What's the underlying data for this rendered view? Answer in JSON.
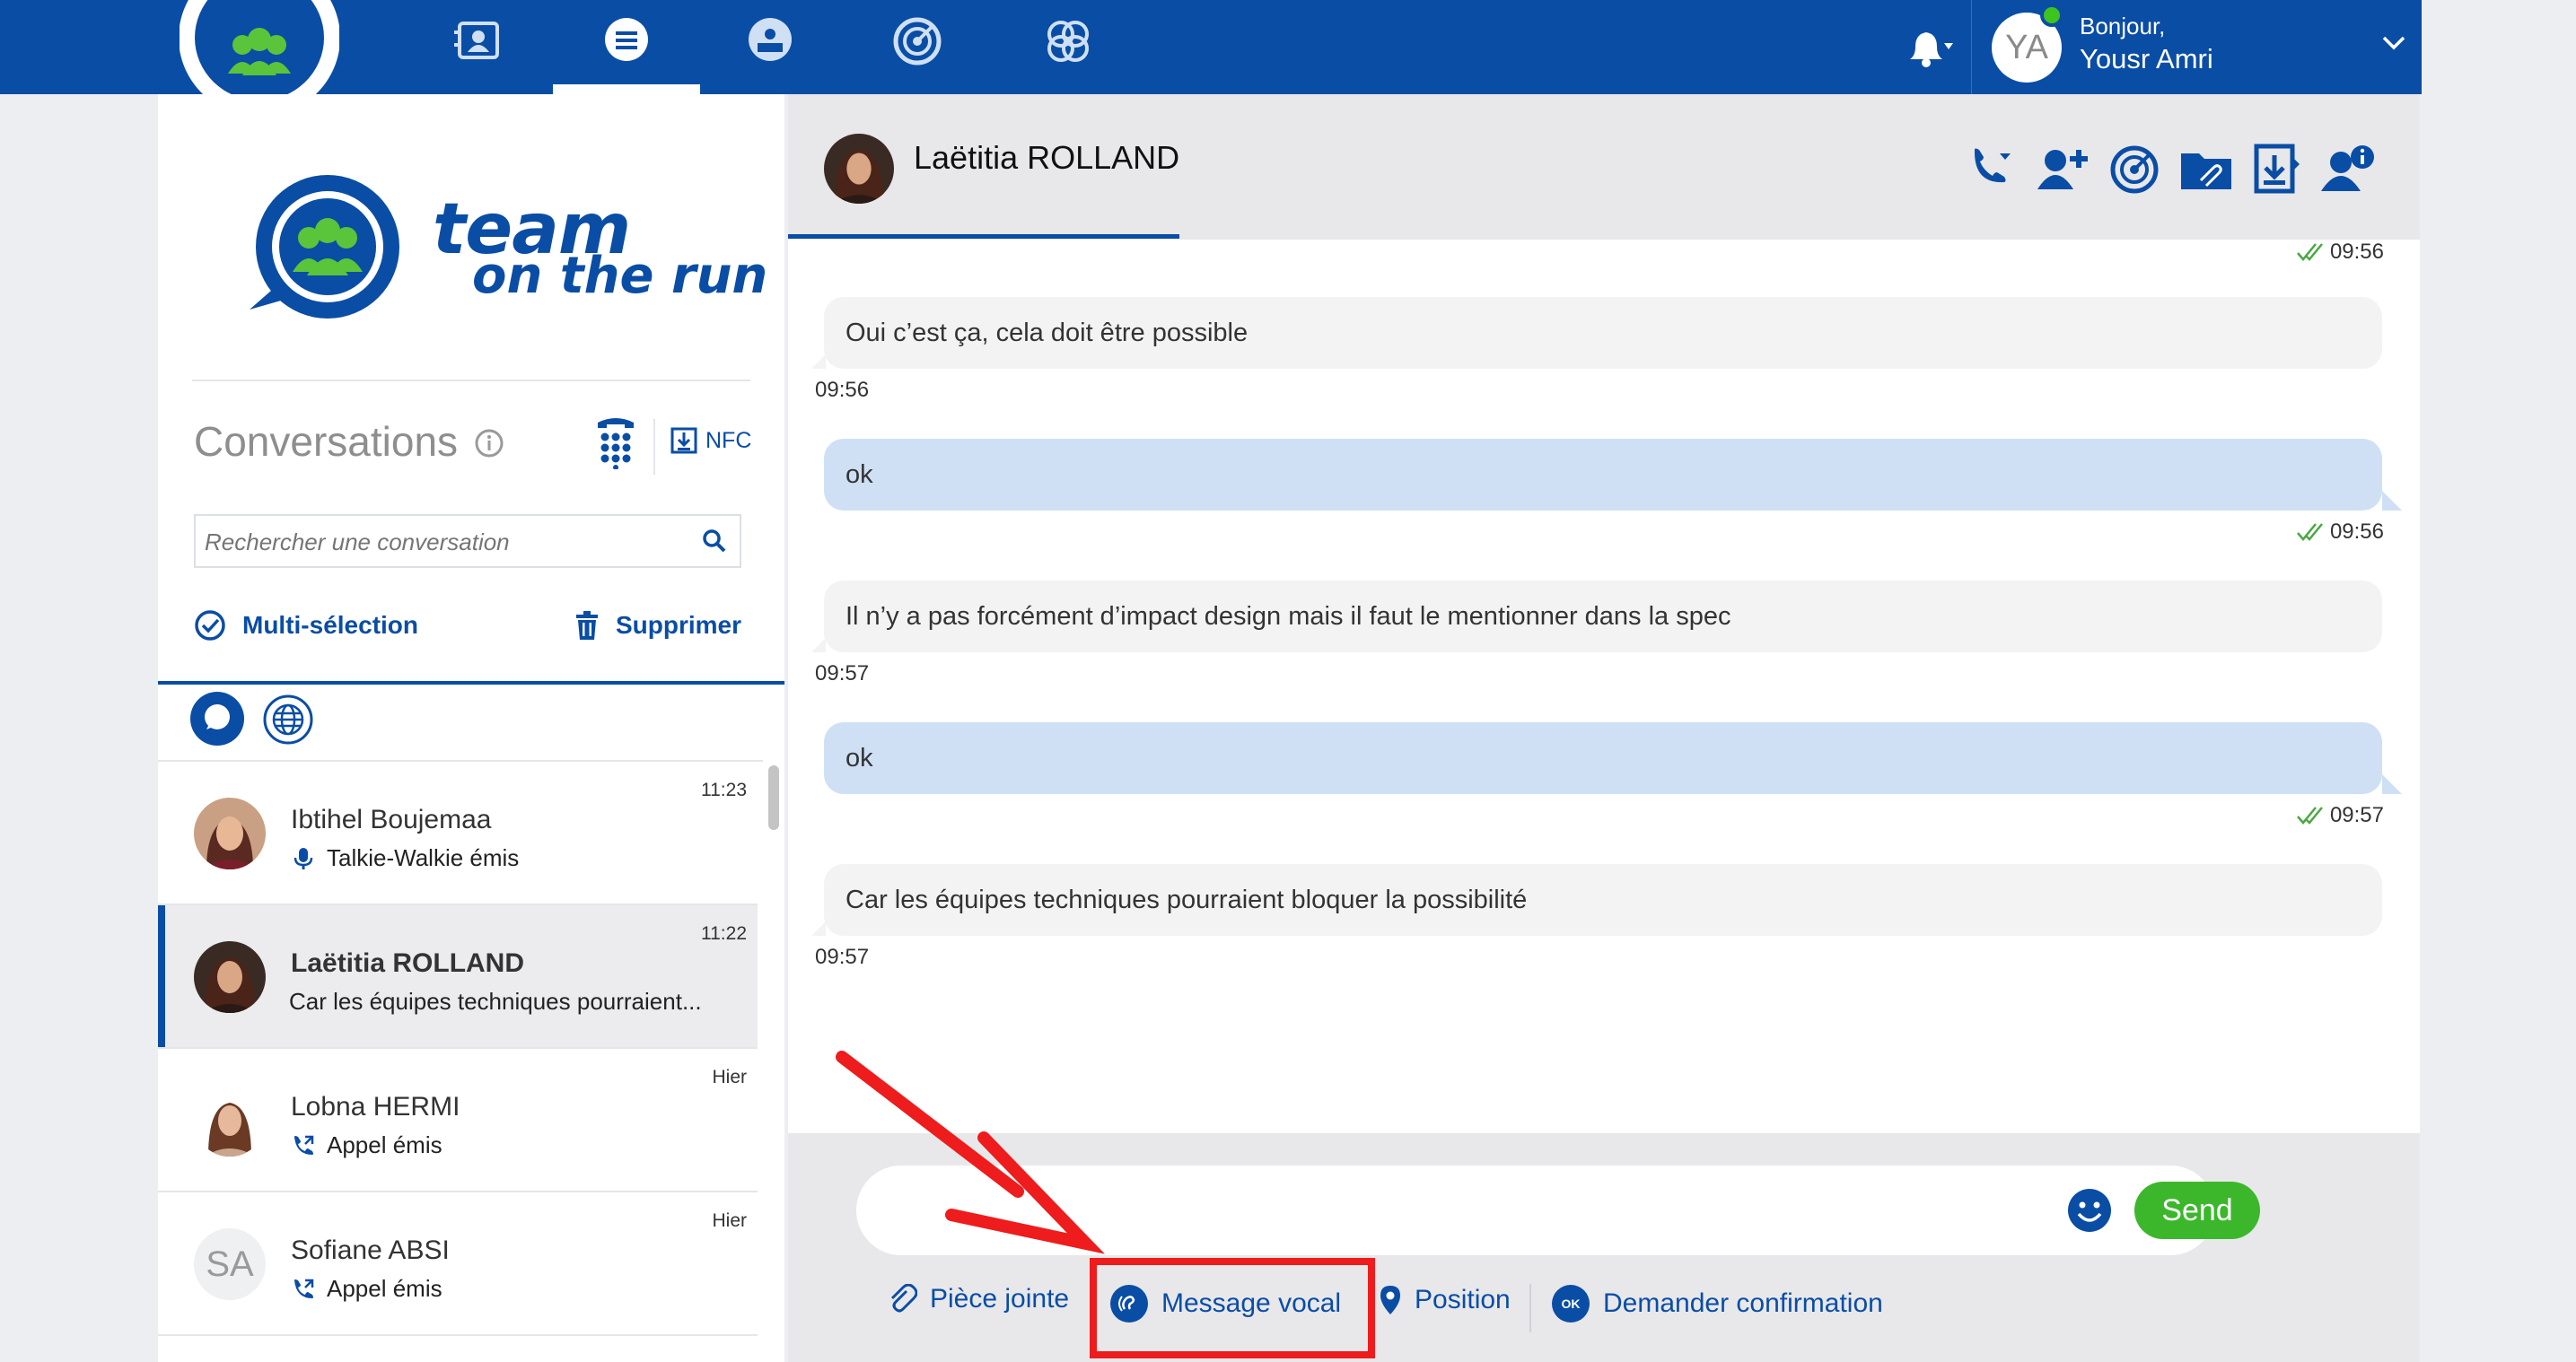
{
  "header": {
    "greeting": "Bonjour,",
    "user_name": "Yousr Amri",
    "user_initials": "YA",
    "nav_icons": [
      "contacts-icon",
      "conversations-icon",
      "broadcast-icon",
      "radar-icon",
      "groups-icon"
    ],
    "colors": {
      "brand_blue": "#0a4da5",
      "online_green": "#3ec41e"
    }
  },
  "sidebar": {
    "brand_line_1": "team",
    "brand_line_2": "on the run",
    "title": "Conversations",
    "nfc_label": "NFC",
    "search_placeholder": "Rechercher une conversation",
    "multi_select_label": "Multi-sélection",
    "delete_label": "Supprimer",
    "conversations": [
      {
        "name": "Ibtihel Boujemaa",
        "time": "11:23",
        "subtitle": "Talkie-Walkie émis",
        "icon": "walkie-talkie-icon"
      },
      {
        "name": "Laëtitia ROLLAND",
        "time": "11:22",
        "subtitle": "Car les équipes techniques pourraient...",
        "icon": ""
      },
      {
        "name": "Lobna HERMI",
        "time": "Hier",
        "subtitle": "Appel émis",
        "icon": "outgoing-call-icon"
      },
      {
        "name": "Sofiane ABSI",
        "time": "Hier",
        "subtitle": "Appel émis",
        "icon": "outgoing-call-icon",
        "initials": "SA"
      }
    ]
  },
  "chat": {
    "contact_name": "Laëtitia ROLLAND",
    "top_time": "09:56",
    "messages": [
      {
        "direction": "in",
        "text": "Oui c’est ça, cela doit être possible",
        "time": "09:56"
      },
      {
        "direction": "out",
        "text": "ok",
        "time": "09:56"
      },
      {
        "direction": "in",
        "text": "Il n’y a pas forcément d’impact design mais il faut le mentionner dans la spec",
        "time": "09:57"
      },
      {
        "direction": "out",
        "text": "ok",
        "time": "09:57"
      },
      {
        "direction": "in",
        "text": "Car les équipes techniques pourraient bloquer la possibilité",
        "time": "09:57"
      }
    ],
    "header_icons": [
      "call-icon",
      "add-user-icon",
      "radar-icon",
      "attachment-folder-icon",
      "download-icon",
      "user-info-icon"
    ]
  },
  "composer": {
    "send_label": "Send",
    "attachment_label": "Pièce jointe",
    "voice_label": "Message vocal",
    "position_label": "Position",
    "confirm_label": "Demander confirmation",
    "ok_badge": "OK"
  }
}
